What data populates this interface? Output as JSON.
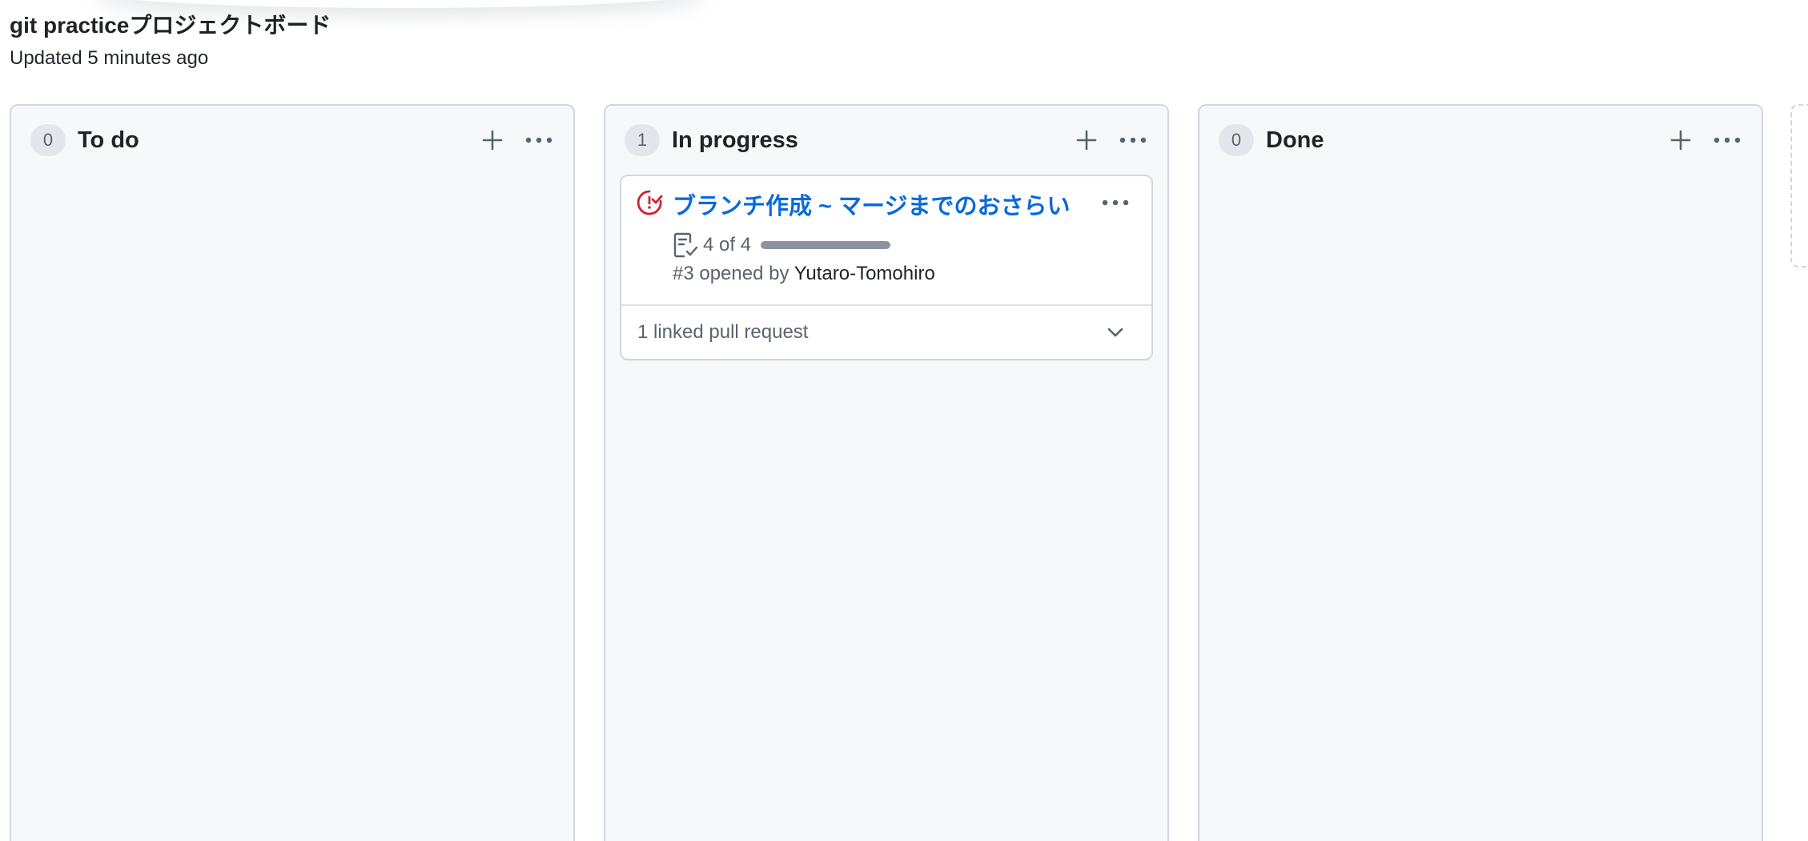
{
  "project": {
    "title": "git practiceプロジェクトボード",
    "updated": "Updated 5 minutes ago"
  },
  "columns": [
    {
      "count": "0",
      "name": "To do",
      "cards": []
    },
    {
      "count": "1",
      "name": "In progress",
      "cards": [
        {
          "title": "ブランチ作成 ~ マージまでのおさらい",
          "status_icon": "issue-closed-icon",
          "status_color": "#cf222e",
          "tasks_text": "4 of 4",
          "tasks_progress_fraction": 1.0,
          "opened_prefix": "#3 opened by",
          "author": "Yutaro-Tomohiro",
          "linked": "1 linked pull request"
        }
      ]
    },
    {
      "count": "0",
      "name": "Done",
      "cards": []
    }
  ],
  "colors": {
    "link": "#0969da",
    "column_bg": "#f6f8fa",
    "border": "#d0d7de"
  }
}
